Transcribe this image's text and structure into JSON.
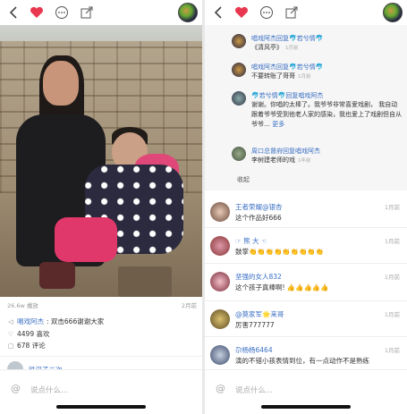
{
  "left": {
    "views": "26.6w 播放",
    "date": "2月前",
    "author_reply": {
      "name": "唱戏阿杰",
      "text": ": 双击666谢谢大家"
    },
    "likes": "4499 喜欢",
    "comments": "678 评论",
    "partial_comment_name": "铁汉子二次",
    "input_placeholder": "说点什么..."
  },
  "right": {
    "replies": [
      {
        "name": "唱戏阿杰回复🐬若兮情🐬",
        "text": "《清风亭》",
        "time": "1月前"
      },
      {
        "name": "唱戏阿杰回复🐬若兮情🐬",
        "text": "不要转账了哥哥",
        "time": "1月前"
      },
      {
        "name": "🐬若兮情🐬回复唱戏阿杰",
        "text": "谢谢。你唱的太棒了。我爷爷非常喜爱戏剧， 我自动跟着爷爷受到他老人家的感染，我也爱上了戏剧但自从爷爷…",
        "more": "更多"
      },
      {
        "name": "周口总督府回复唱戏阿杰",
        "text": "李树建老师的戏",
        "time": "1年前"
      }
    ],
    "collapse_label": "收起",
    "comments": [
      {
        "name": "王者荣耀@银杏",
        "text": "这个作品好666",
        "date": "1月前"
      },
      {
        "name": "☞ 熊 大 ☜",
        "text": "鼓掌👏👏👏👏👏👏👏👏👏",
        "date": "1月前"
      },
      {
        "name": "坚强的女人832",
        "text": "这个孩子真棒啊! 👍👍👍👍👍",
        "date": "1月前"
      },
      {
        "name": "@莫家军🌟来哥",
        "text": "厉害777777",
        "date": "1月前"
      },
      {
        "name": "尕杨杨6464",
        "text": "演的不错小孩表情到位，有一点动作不是熟练",
        "date": "1月前"
      }
    ],
    "input_placeholder": "说点什么..."
  },
  "colors": {
    "accent_red": "#e8384f",
    "link_blue": "#3a6fc4"
  },
  "icons": [
    "back-arrow-icon",
    "heart-icon",
    "more-dots-icon",
    "share-icon",
    "at-icon",
    "comment-icon",
    "like-icon"
  ]
}
